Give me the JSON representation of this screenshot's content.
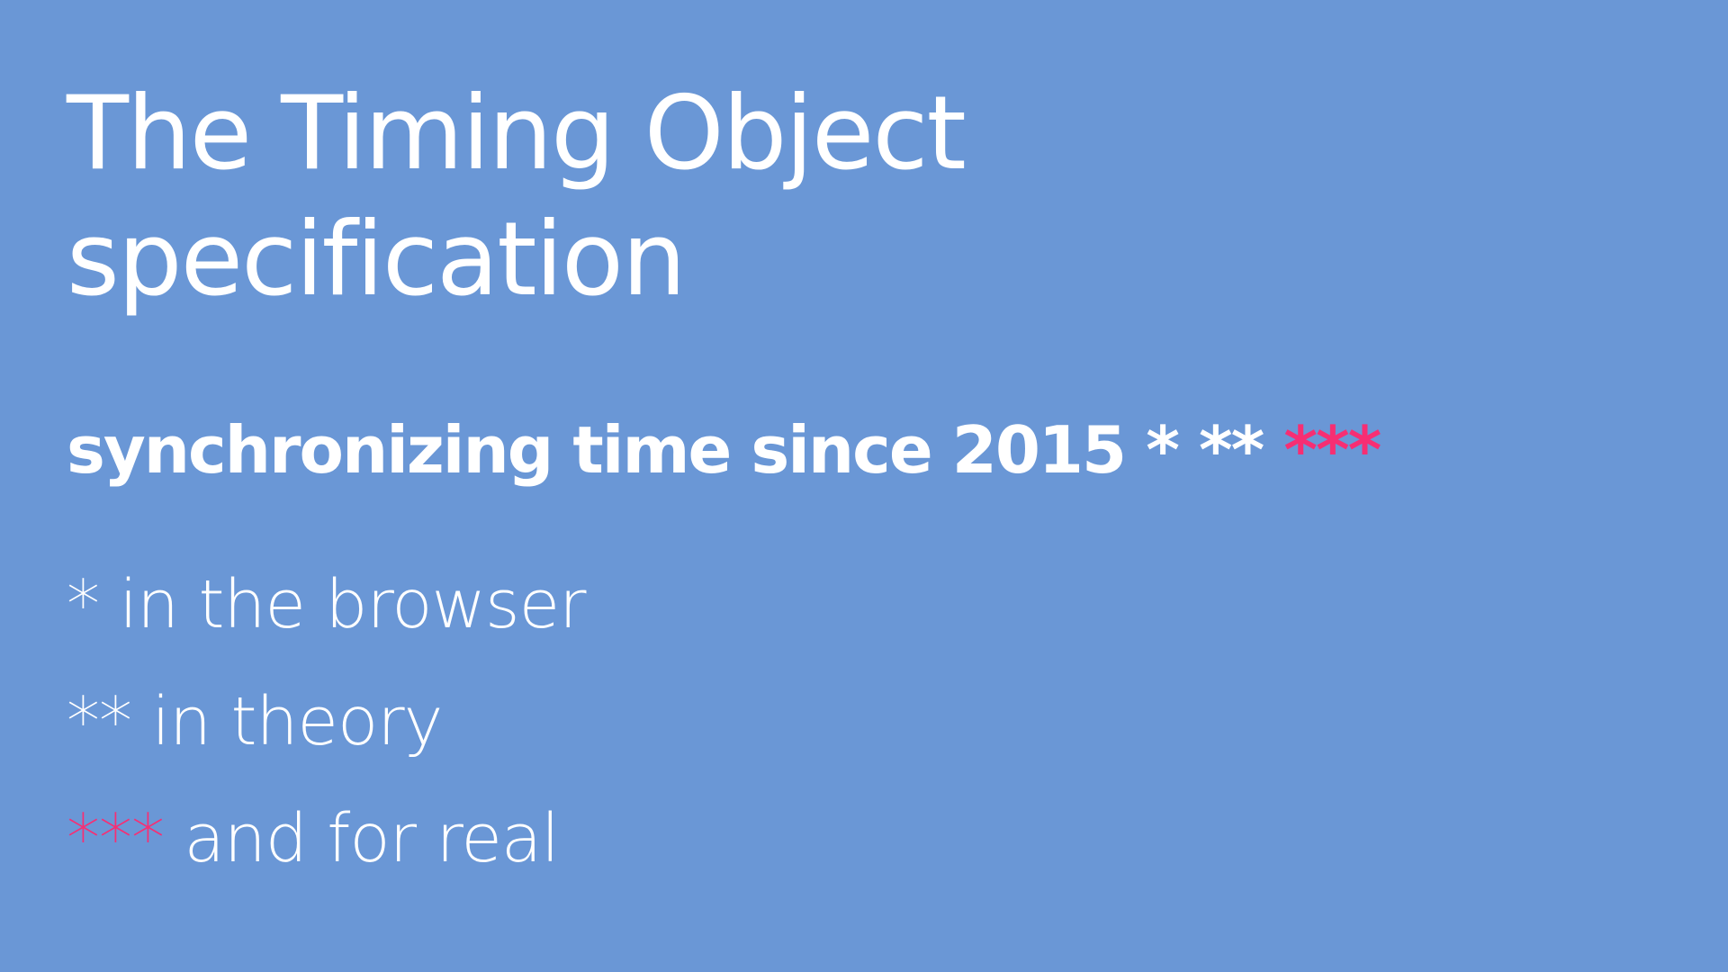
{
  "slide": {
    "title_line1": "The Timing Object",
    "title_line2": "specification",
    "subtitle": {
      "text": "synchronizing time since 2015",
      "mark1": "*",
      "mark2": "**",
      "mark3": "***"
    },
    "footnotes": [
      {
        "marker": "*",
        "text": "in the browser"
      },
      {
        "marker": "**",
        "text": "in theory"
      },
      {
        "marker": "***",
        "text": "and for real"
      }
    ]
  },
  "colors": {
    "background": "#6a97d6",
    "text": "#ffffff",
    "accent": "#f72e73"
  }
}
